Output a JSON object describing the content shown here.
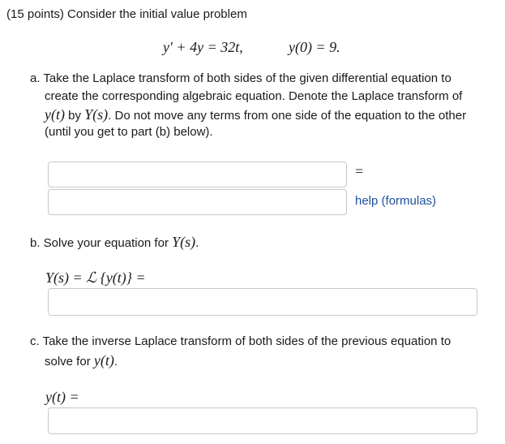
{
  "problem": {
    "intro": "(15 points) Consider the initial value problem",
    "equation_de": "y′ + 4y = 32t,",
    "equation_ic": "y(0) = 9."
  },
  "part_a": {
    "line1": "a. Take the Laplace transform of both sides of the given differential equation to",
    "line2": "create the corresponding algebraic equation. Denote the Laplace transform of",
    "line3_math1": "y(t)",
    "line3_by": " by ",
    "line3_math2": "Y(s)",
    "line3_rest": ". Do not move any terms from one side of the equation to the other",
    "line4": "(until you get to part (b) below).",
    "equals": "=",
    "help_label": "help (formulas)",
    "lhs_value": "",
    "rhs_value": ""
  },
  "part_b": {
    "prompt_text": "b. Solve your equation for ",
    "prompt_math": "Y(s)",
    "prompt_end": ".",
    "lhs_label": "Y(s) = ℒ {y(t)} =",
    "answer_value": ""
  },
  "part_c": {
    "line1": "c. Take the inverse Laplace transform of both sides of the previous equation to",
    "line2_text": "solve for ",
    "line2_math": "y(t)",
    "line2_end": ".",
    "lhs_label": "y(t) =",
    "answer_value": ""
  }
}
